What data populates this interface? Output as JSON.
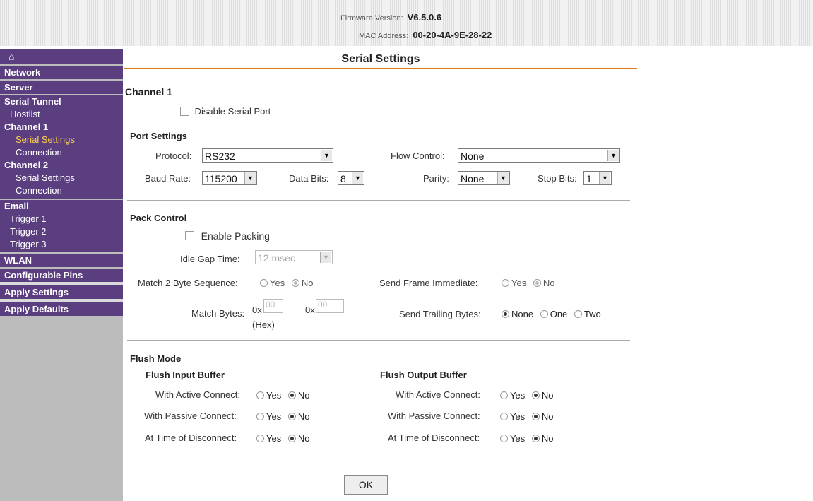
{
  "header": {
    "firmware_label": "Firmware Version:",
    "firmware_value": "V6.5.0.6",
    "mac_label": "MAC Address:",
    "mac_value": "00-20-4A-9E-28-22"
  },
  "sidebar": {
    "home_icon": "⌂",
    "network": "Network",
    "server": "Server",
    "serial_tunnel": "Serial Tunnel",
    "hostlist": "Hostlist",
    "channel1": "Channel 1",
    "channel1_serial": "Serial Settings",
    "channel1_connection": "Connection",
    "channel2": "Channel 2",
    "channel2_serial": "Serial Settings",
    "channel2_connection": "Connection",
    "email": "Email",
    "trigger1": "Trigger 1",
    "trigger2": "Trigger 2",
    "trigger3": "Trigger 3",
    "wlan": "WLAN",
    "configurable_pins": "Configurable Pins",
    "apply_settings": "Apply Settings",
    "apply_defaults": "Apply Defaults"
  },
  "page": {
    "title": "Serial Settings",
    "channel": "Channel 1",
    "disable_serial_port": "Disable Serial Port"
  },
  "port_settings": {
    "heading": "Port Settings",
    "protocol_label": "Protocol:",
    "protocol_value": "RS232",
    "flow_control_label": "Flow Control:",
    "flow_control_value": "None",
    "baud_rate_label": "Baud Rate:",
    "baud_rate_value": "115200",
    "data_bits_label": "Data Bits:",
    "data_bits_value": "8",
    "parity_label": "Parity:",
    "parity_value": "None",
    "stop_bits_label": "Stop Bits:",
    "stop_bits_value": "1"
  },
  "pack_control": {
    "heading": "Pack Control",
    "enable_packing": "Enable Packing",
    "idle_gap_label": "Idle Gap Time:",
    "idle_gap_value": "12 msec",
    "match2_label": "Match 2 Byte Sequence:",
    "send_frame_label": "Send Frame Immediate:",
    "yes": "Yes",
    "no": "No",
    "match_bytes_label": "Match Bytes:",
    "prefix": "0x",
    "byte1": "00",
    "byte2": "00",
    "hex": "(Hex)",
    "trailing_label": "Send Trailing Bytes:",
    "none": "None",
    "one": "One",
    "two": "Two"
  },
  "flush_mode": {
    "heading": "Flush Mode",
    "input_heading": "Flush Input Buffer",
    "output_heading": "Flush Output Buffer",
    "active": "With Active Connect:",
    "passive": "With Passive Connect:",
    "disconnect": "At Time of Disconnect:",
    "yes": "Yes",
    "no": "No"
  },
  "ok_label": "OK"
}
